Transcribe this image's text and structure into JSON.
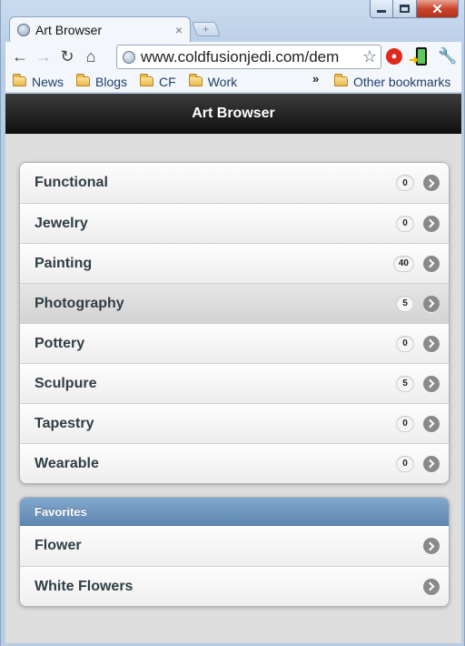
{
  "browser": {
    "tab_title": "Art Browser",
    "tab_close": "×",
    "new_tab": "+",
    "url": "www.coldfusionjedi.com/dem",
    "bookmarks": [
      "News",
      "Blogs",
      "CF",
      "Work"
    ],
    "chevron": "»",
    "other_bookmarks": "Other bookmarks",
    "close_glyph": "✕"
  },
  "page": {
    "header_title": "Art Browser",
    "categories": [
      {
        "label": "Functional",
        "count": "0"
      },
      {
        "label": "Jewelry",
        "count": "0"
      },
      {
        "label": "Painting",
        "count": "40"
      },
      {
        "label": "Photography",
        "count": "5"
      },
      {
        "label": "Pottery",
        "count": "0"
      },
      {
        "label": "Sculpure",
        "count": "5"
      },
      {
        "label": "Tapestry",
        "count": "0"
      },
      {
        "label": "Wearable",
        "count": "0"
      }
    ],
    "favorites_title": "Favorites",
    "favorites": [
      {
        "label": "Flower"
      },
      {
        "label": "White Flowers"
      }
    ]
  },
  "icons": {
    "back": "back-arrow-icon",
    "forward": "forward-arrow-icon",
    "reload": "reload-icon",
    "home": "home-icon",
    "star": "star-icon",
    "wrench": "wrench-icon"
  },
  "colors": {
    "header_bg": "#1f1f1f",
    "divider_bg": "#6f98c0",
    "count_bubble": "#f5f5f5"
  }
}
